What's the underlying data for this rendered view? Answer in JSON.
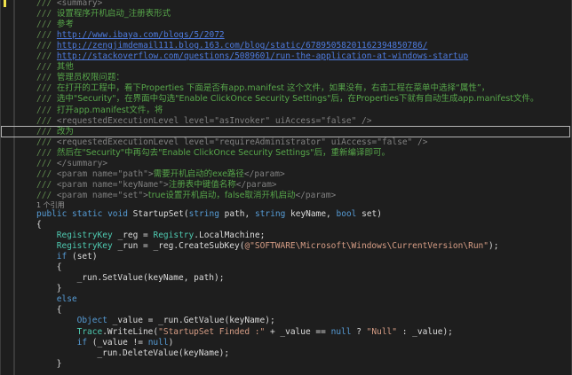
{
  "editor": {
    "codelens": "1 个引用",
    "lines": [
      {
        "indent": 12,
        "kind": "doc",
        "segments": [
          [
            "c-doc",
            "/// "
          ],
          [
            "c-tag",
            "<summary>"
          ]
        ]
      },
      {
        "indent": 12,
        "kind": "doc",
        "segments": [
          [
            "c-doc",
            "/// "
          ],
          [
            "c-cn",
            "设置程序开机启动_注册表形式"
          ]
        ]
      },
      {
        "indent": 12,
        "kind": "doc",
        "segments": [
          [
            "c-doc",
            "/// "
          ],
          [
            "c-cn",
            "参考"
          ]
        ]
      },
      {
        "indent": 12,
        "kind": "doc",
        "segments": [
          [
            "c-doc",
            "/// "
          ],
          [
            "c-url",
            "http://www.ibaya.com/blogs/5/2072"
          ]
        ]
      },
      {
        "indent": 12,
        "kind": "doc",
        "segments": [
          [
            "c-doc",
            "/// "
          ],
          [
            "c-url",
            "http://zengjimdemail111.blog.163.com/blog/static/67895058201162394850786/"
          ]
        ]
      },
      {
        "indent": 12,
        "kind": "doc",
        "segments": [
          [
            "c-doc",
            "/// "
          ],
          [
            "c-url",
            "http://stackoverflow.com/questions/5089601/run-the-application-at-windows-startup"
          ]
        ]
      },
      {
        "indent": 12,
        "kind": "doc",
        "segments": [
          [
            "c-doc",
            "/// "
          ],
          [
            "c-cn",
            "其他"
          ]
        ]
      },
      {
        "indent": 12,
        "kind": "doc",
        "segments": [
          [
            "c-doc",
            "/// "
          ],
          [
            "c-cn",
            "管理员权限问题："
          ]
        ]
      },
      {
        "indent": 12,
        "kind": "doc",
        "segments": [
          [
            "c-doc",
            "/// "
          ],
          [
            "c-cn",
            "在打开的工程中，看下Properties 下面是否有app.manifest 这个文件，如果没有，右击工程在菜单中选择“属性”，"
          ]
        ]
      },
      {
        "indent": 12,
        "kind": "doc",
        "segments": [
          [
            "c-doc",
            "/// "
          ],
          [
            "c-cn",
            "选中\"Security\"，在界面中勾选\"Enable ClickOnce Security Settings\"后，在Properties下就有自动生成app.manifest文件。"
          ]
        ]
      },
      {
        "indent": 12,
        "kind": "doc",
        "segments": [
          [
            "c-doc",
            "/// "
          ],
          [
            "c-cn",
            "打开app.manifest文件，将"
          ]
        ]
      },
      {
        "indent": 12,
        "kind": "doc",
        "segments": [
          [
            "c-doc",
            "/// "
          ],
          [
            "c-tag",
            "<requestedExecutionLevel level=\"asInvoker\" uiAccess=\"false\" />"
          ]
        ]
      },
      {
        "indent": 12,
        "kind": "doc",
        "current": true,
        "segments": [
          [
            "c-doc",
            "/// "
          ],
          [
            "c-cn",
            "改为"
          ]
        ]
      },
      {
        "indent": 12,
        "kind": "doc",
        "segments": [
          [
            "c-doc",
            "/// "
          ],
          [
            "c-tag",
            "<requestedExecutionLevel level=\"requireAdministrator\" uiAccess=\"false\" />"
          ]
        ]
      },
      {
        "indent": 12,
        "kind": "doc",
        "segments": [
          [
            "c-doc",
            "/// "
          ],
          [
            "c-cn",
            "然后在\"Security\"中再勾去\"Enable ClickOnce Security Settings\"后，重新编译即可。"
          ]
        ]
      },
      {
        "indent": 12,
        "kind": "doc",
        "segments": [
          [
            "c-doc",
            "/// "
          ],
          [
            "c-tag",
            "</summary>"
          ]
        ]
      },
      {
        "indent": 12,
        "kind": "doc",
        "segments": [
          [
            "c-doc",
            "/// "
          ],
          [
            "c-tag",
            "<param name=\"path\">"
          ],
          [
            "c-cn",
            "需要开机启动的exe路径"
          ],
          [
            "c-tag",
            "</param>"
          ]
        ]
      },
      {
        "indent": 12,
        "kind": "doc",
        "segments": [
          [
            "c-doc",
            "/// "
          ],
          [
            "c-tag",
            "<param name=\"keyName\">"
          ],
          [
            "c-cn",
            "注册表中键值名称"
          ],
          [
            "c-tag",
            "</param>"
          ]
        ]
      },
      {
        "indent": 12,
        "kind": "doc",
        "segments": [
          [
            "c-doc",
            "/// "
          ],
          [
            "c-tag",
            "<param name=\"set\">"
          ],
          [
            "c-cn",
            "true设置开机启动，false取消开机启动"
          ],
          [
            "c-tag",
            "</param>"
          ]
        ]
      },
      {
        "indent": 12,
        "kind": "codelens",
        "segments": []
      },
      {
        "indent": 12,
        "kind": "code",
        "segments": [
          [
            "c-kw",
            "public static void "
          ],
          [
            "c-plain",
            "StartupSet("
          ],
          [
            "c-kw",
            "string "
          ],
          [
            "c-plain",
            "path, "
          ],
          [
            "c-kw",
            "string "
          ],
          [
            "c-plain",
            "keyName, "
          ],
          [
            "c-kw",
            "bool "
          ],
          [
            "c-plain",
            "set)"
          ]
        ]
      },
      {
        "indent": 12,
        "kind": "code",
        "segments": [
          [
            "c-plain",
            "{"
          ]
        ]
      },
      {
        "indent": 20,
        "kind": "code",
        "segments": [
          [
            "c-type",
            "RegistryKey "
          ],
          [
            "c-plain",
            "_reg = "
          ],
          [
            "c-type",
            "Registry"
          ],
          [
            "c-plain",
            ".LocalMachine;"
          ]
        ]
      },
      {
        "indent": 20,
        "kind": "code",
        "segments": [
          [
            "c-type",
            "RegistryKey "
          ],
          [
            "c-plain",
            "_run = _reg.CreateSubKey("
          ],
          [
            "c-str",
            "@\"SOFTWARE\\Microsoft\\Windows\\CurrentVersion\\Run\""
          ],
          [
            "c-plain",
            ");"
          ]
        ]
      },
      {
        "indent": 20,
        "kind": "code",
        "segments": [
          [
            "c-kw",
            "if "
          ],
          [
            "c-plain",
            "(set)"
          ]
        ]
      },
      {
        "indent": 20,
        "kind": "code",
        "segments": [
          [
            "c-plain",
            "{"
          ]
        ]
      },
      {
        "indent": 28,
        "kind": "code",
        "segments": [
          [
            "c-plain",
            "_run.SetValue(keyName, path);"
          ]
        ]
      },
      {
        "indent": 20,
        "kind": "code",
        "segments": [
          [
            "c-plain",
            "}"
          ]
        ]
      },
      {
        "indent": 20,
        "kind": "code",
        "segments": [
          [
            "c-kw",
            "else"
          ]
        ]
      },
      {
        "indent": 20,
        "kind": "code",
        "segments": [
          [
            "c-plain",
            "{"
          ]
        ]
      },
      {
        "indent": 28,
        "kind": "code",
        "segments": [
          [
            "c-kw",
            "Object "
          ],
          [
            "c-plain",
            "_value = _run.GetValue(keyName);"
          ]
        ]
      },
      {
        "indent": 28,
        "kind": "code",
        "segments": [
          [
            "c-type",
            "Trace"
          ],
          [
            "c-plain",
            ".WriteLine("
          ],
          [
            "c-str",
            "\"StartupSet Finded :\""
          ],
          [
            "c-plain",
            " + _value == "
          ],
          [
            "c-kw",
            "null"
          ],
          [
            "c-plain",
            " ? "
          ],
          [
            "c-str",
            "\"Null\""
          ],
          [
            "c-plain",
            " : _value);"
          ]
        ]
      },
      {
        "indent": 28,
        "kind": "code",
        "segments": [
          [
            "c-kw",
            "if "
          ],
          [
            "c-plain",
            "(_value != "
          ],
          [
            "c-kw",
            "null"
          ],
          [
            "c-plain",
            ")"
          ]
        ]
      },
      {
        "indent": 36,
        "kind": "code",
        "segments": [
          [
            "c-plain",
            "_run.DeleteValue(keyName);"
          ]
        ]
      },
      {
        "indent": 20,
        "kind": "code",
        "segments": [
          [
            "c-plain",
            "}"
          ]
        ]
      }
    ]
  }
}
